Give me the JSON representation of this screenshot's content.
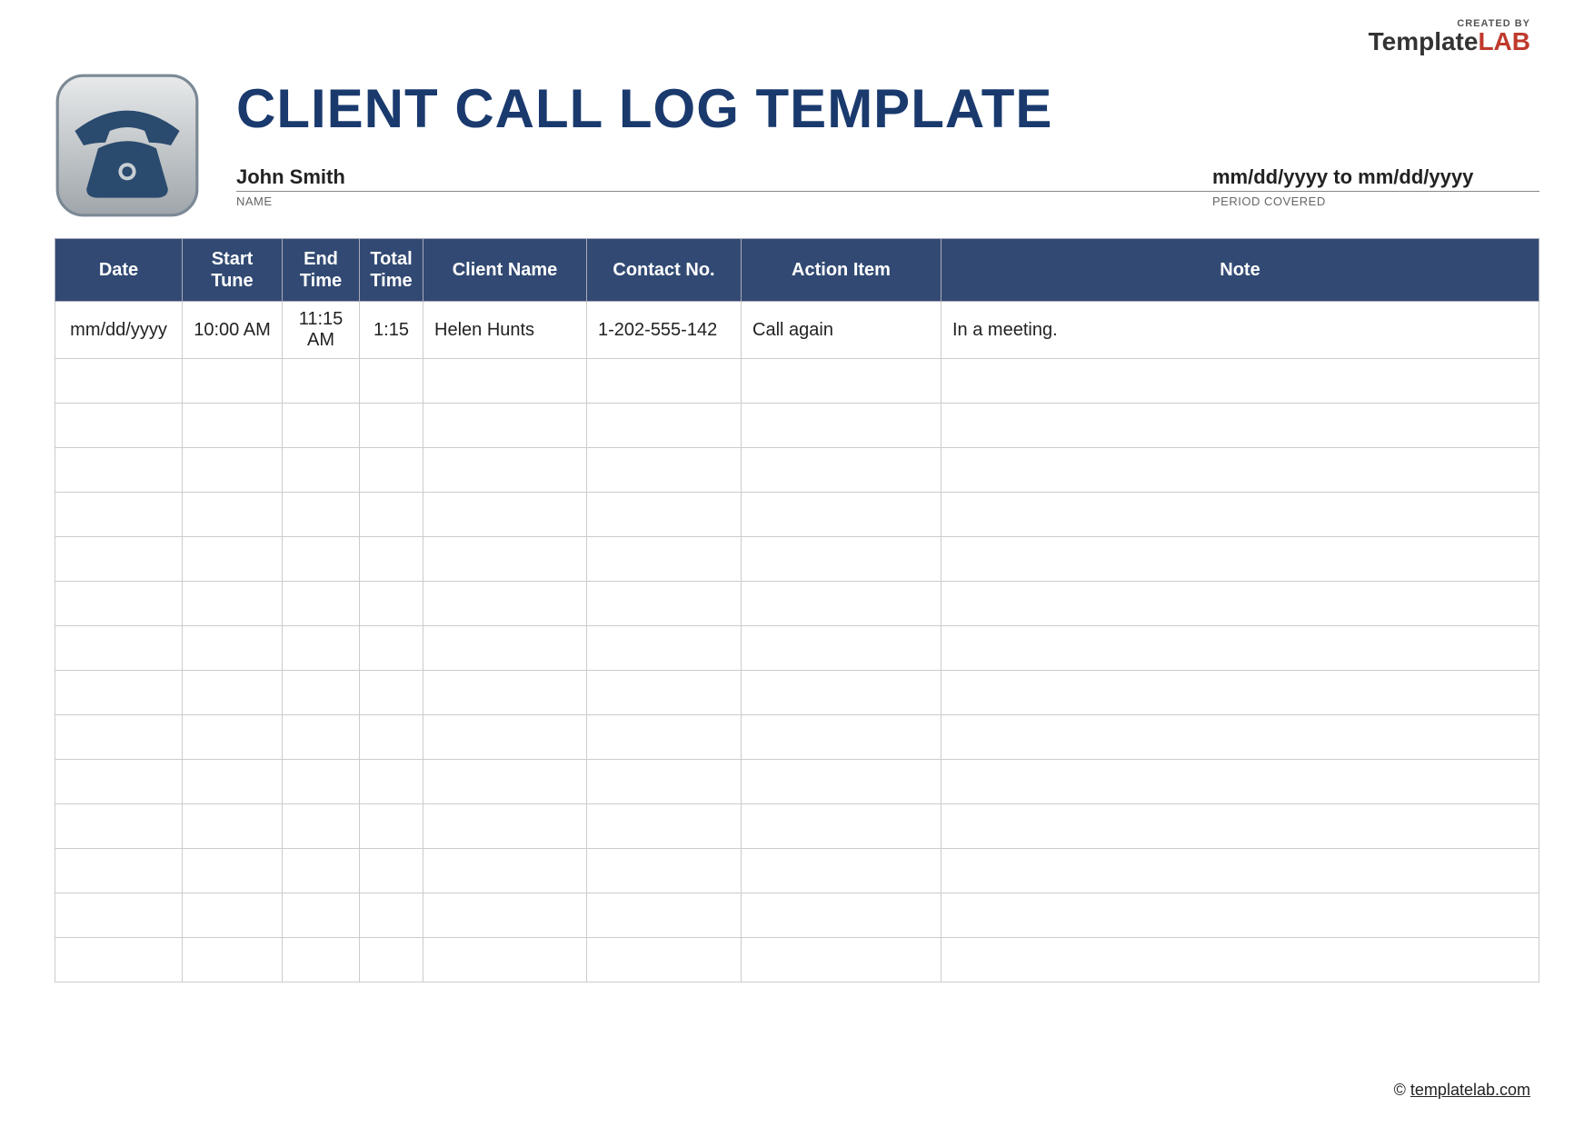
{
  "brand": {
    "created_by": "CREATED BY",
    "name_part1": "Template",
    "name_part2": "LAB"
  },
  "title": "CLIENT CALL LOG TEMPLATE",
  "meta": {
    "name_value": "John Smith",
    "name_label": "NAME",
    "period_value": "mm/dd/yyyy to mm/dd/yyyy",
    "period_label": "PERIOD COVERED"
  },
  "table": {
    "headers": {
      "date": "Date",
      "start": "Start Tune",
      "end": "End Time",
      "total": "Total Time",
      "client": "Client Name",
      "contact": "Contact No.",
      "action": "Action Item",
      "note": "Note"
    },
    "rows": [
      {
        "date": "mm/dd/yyyy",
        "start": "10:00 AM",
        "end": "11:15 AM",
        "total": "1:15",
        "client": "Helen Hunts",
        "contact": "1-202-555-142",
        "action": "Call again",
        "note": "In a meeting."
      },
      {
        "date": "",
        "start": "",
        "end": "",
        "total": "",
        "client": "",
        "contact": "",
        "action": "",
        "note": ""
      },
      {
        "date": "",
        "start": "",
        "end": "",
        "total": "",
        "client": "",
        "contact": "",
        "action": "",
        "note": ""
      },
      {
        "date": "",
        "start": "",
        "end": "",
        "total": "",
        "client": "",
        "contact": "",
        "action": "",
        "note": ""
      },
      {
        "date": "",
        "start": "",
        "end": "",
        "total": "",
        "client": "",
        "contact": "",
        "action": "",
        "note": ""
      },
      {
        "date": "",
        "start": "",
        "end": "",
        "total": "",
        "client": "",
        "contact": "",
        "action": "",
        "note": ""
      },
      {
        "date": "",
        "start": "",
        "end": "",
        "total": "",
        "client": "",
        "contact": "",
        "action": "",
        "note": ""
      },
      {
        "date": "",
        "start": "",
        "end": "",
        "total": "",
        "client": "",
        "contact": "",
        "action": "",
        "note": ""
      },
      {
        "date": "",
        "start": "",
        "end": "",
        "total": "",
        "client": "",
        "contact": "",
        "action": "",
        "note": ""
      },
      {
        "date": "",
        "start": "",
        "end": "",
        "total": "",
        "client": "",
        "contact": "",
        "action": "",
        "note": ""
      },
      {
        "date": "",
        "start": "",
        "end": "",
        "total": "",
        "client": "",
        "contact": "",
        "action": "",
        "note": ""
      },
      {
        "date": "",
        "start": "",
        "end": "",
        "total": "",
        "client": "",
        "contact": "",
        "action": "",
        "note": ""
      },
      {
        "date": "",
        "start": "",
        "end": "",
        "total": "",
        "client": "",
        "contact": "",
        "action": "",
        "note": ""
      },
      {
        "date": "",
        "start": "",
        "end": "",
        "total": "",
        "client": "",
        "contact": "",
        "action": "",
        "note": ""
      },
      {
        "date": "",
        "start": "",
        "end": "",
        "total": "",
        "client": "",
        "contact": "",
        "action": "",
        "note": ""
      }
    ]
  },
  "footer": {
    "copyright": "©",
    "url": "templatelab.com"
  }
}
